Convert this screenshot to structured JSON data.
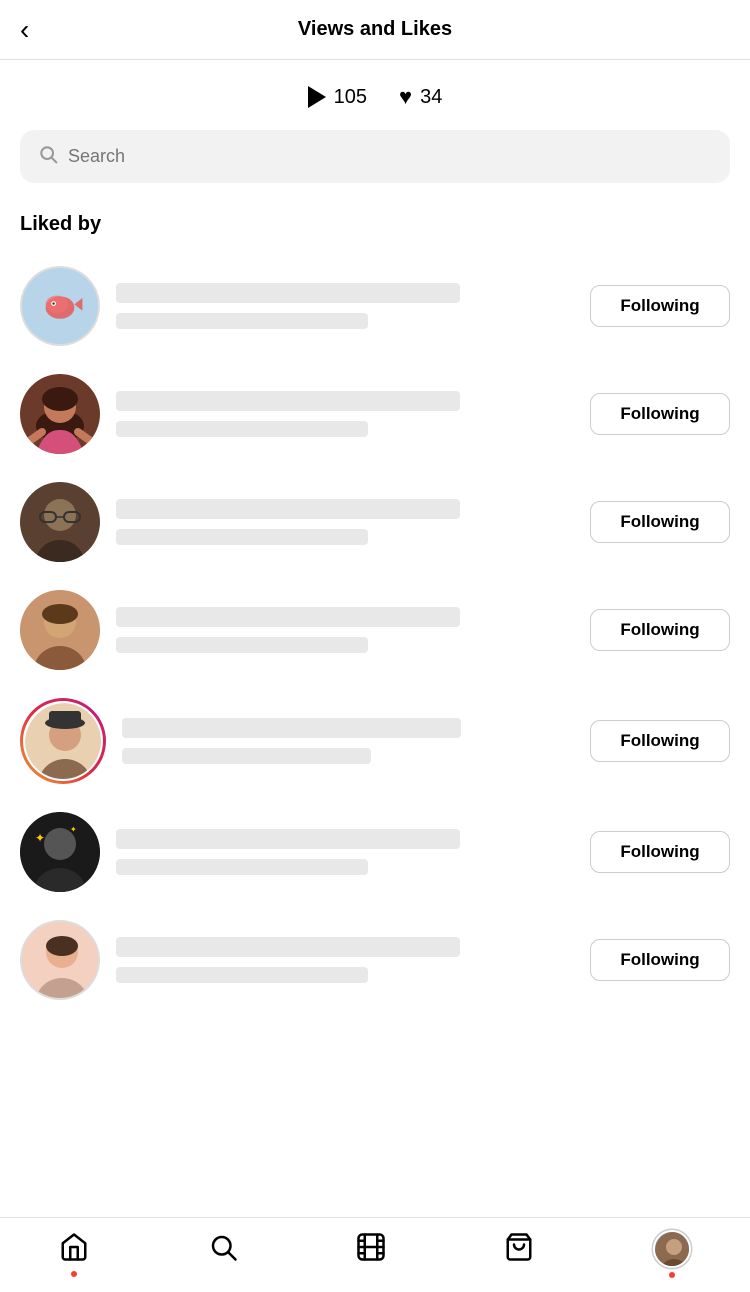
{
  "header": {
    "title": "Views and Likes",
    "back_label": "‹"
  },
  "stats": {
    "views_count": "105",
    "likes_count": "34"
  },
  "search": {
    "placeholder": "Search"
  },
  "section": {
    "title": "Liked by"
  },
  "users": [
    {
      "id": 1,
      "following_label": "Following",
      "has_story": false,
      "avatar_type": "fish"
    },
    {
      "id": 2,
      "following_label": "Following",
      "has_story": false,
      "avatar_type": "photo"
    },
    {
      "id": 3,
      "following_label": "Following",
      "has_story": false,
      "avatar_type": "photo"
    },
    {
      "id": 4,
      "following_label": "Following",
      "has_story": false,
      "avatar_type": "photo"
    },
    {
      "id": 5,
      "following_label": "Following",
      "has_story": true,
      "avatar_type": "photo"
    },
    {
      "id": 6,
      "following_label": "Following",
      "has_story": false,
      "avatar_type": "photo"
    },
    {
      "id": 7,
      "following_label": "Following",
      "has_story": false,
      "avatar_type": "photo"
    }
  ],
  "bottom_nav": {
    "home_label": "home",
    "search_label": "search",
    "reels_label": "reels",
    "shop_label": "shop",
    "profile_label": "profile"
  }
}
